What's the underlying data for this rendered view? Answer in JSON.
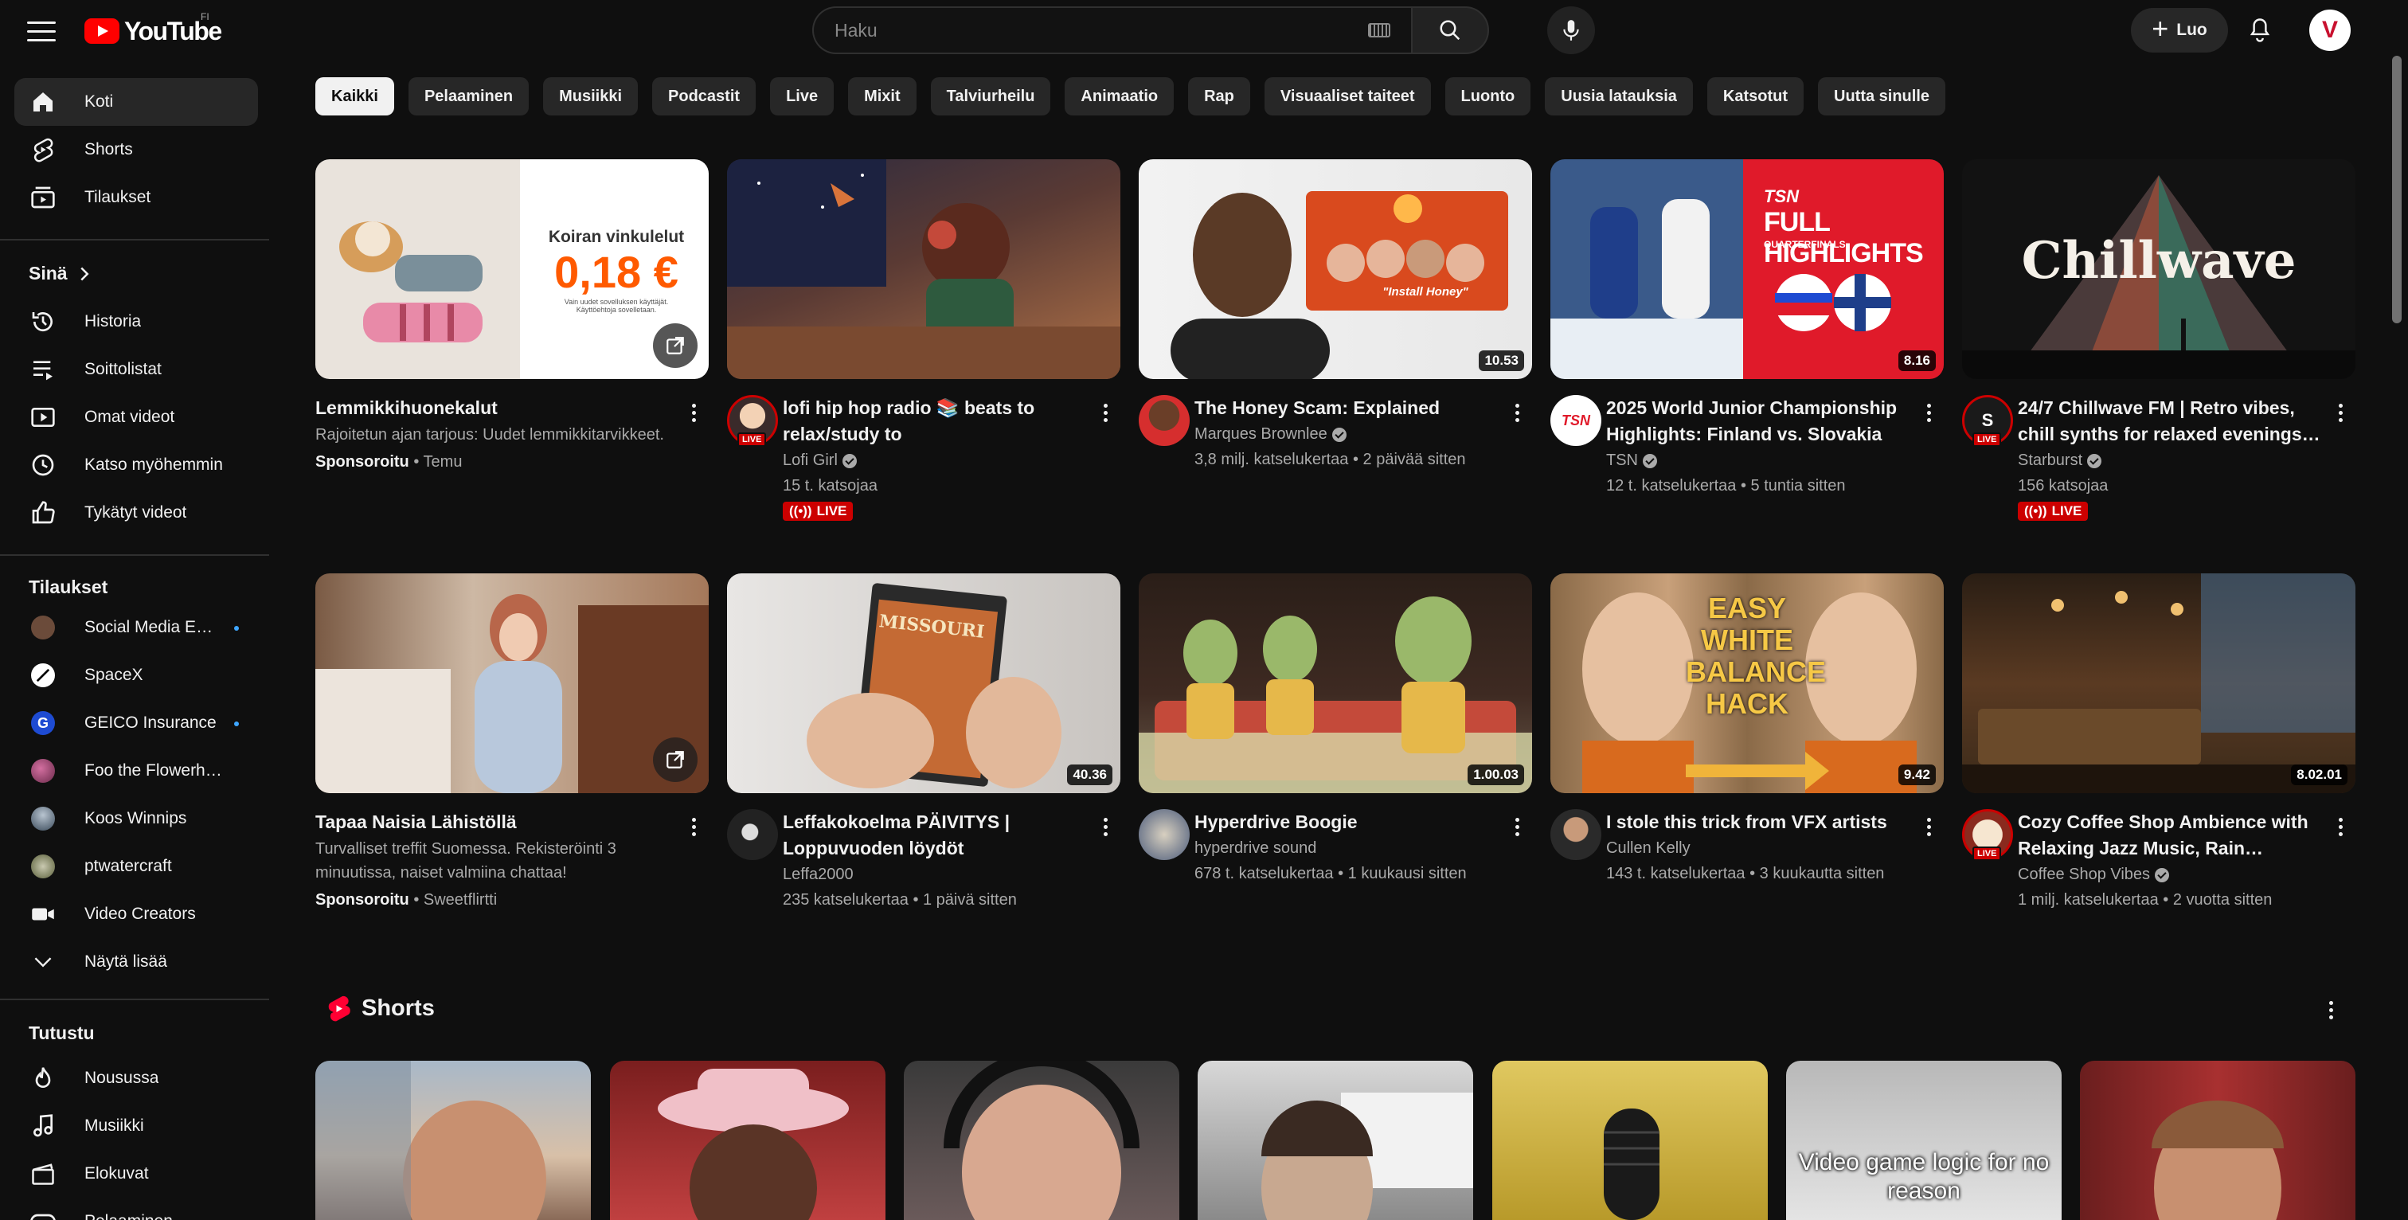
{
  "header": {
    "logo_text": "YouTube",
    "country_code": "FI",
    "search_placeholder": "Haku",
    "create_label": "Luo",
    "avatar_letter": "V"
  },
  "sidebar": {
    "main": [
      {
        "label": "Koti",
        "icon": "home-icon",
        "active": true
      },
      {
        "label": "Shorts",
        "icon": "shorts-icon"
      },
      {
        "label": "Tilaukset",
        "icon": "subscriptions-icon"
      }
    ],
    "you_heading": "Sinä",
    "you": [
      {
        "label": "Historia",
        "icon": "history-icon"
      },
      {
        "label": "Soittolistat",
        "icon": "playlists-icon"
      },
      {
        "label": "Omat videot",
        "icon": "your-videos-icon"
      },
      {
        "label": "Katso myöhemmin",
        "icon": "watch-later-icon"
      },
      {
        "label": "Tykätyt videot",
        "icon": "liked-videos-icon"
      }
    ],
    "subs_heading": "Tilaukset",
    "subscriptions": [
      {
        "label": "Social Media Examiner",
        "color": "#6b4b3a",
        "new": true
      },
      {
        "label": "SpaceX",
        "color": "#ffffff"
      },
      {
        "label": "GEICO Insurance",
        "color": "#1e4bd2",
        "new": true
      },
      {
        "label": "Foo the Flowerhorn",
        "color": "#b04a7a"
      },
      {
        "label": "Koos Winnips",
        "color": "#5a6a7a"
      },
      {
        "label": "ptwatercraft",
        "color": "#8a8f6a"
      },
      {
        "label": "Video Creators",
        "icon": "video-camera-icon"
      }
    ],
    "show_more": "Näytä lisää",
    "explore_heading": "Tutustu",
    "explore": [
      {
        "label": "Nousussa",
        "icon": "trending-icon"
      },
      {
        "label": "Musiikki",
        "icon": "music-icon"
      },
      {
        "label": "Elokuvat",
        "icon": "movies-icon"
      },
      {
        "label": "Pelaaminen",
        "icon": "gaming-icon"
      }
    ]
  },
  "chips": [
    "Kaikki",
    "Pelaaminen",
    "Musiikki",
    "Podcastit",
    "Live",
    "Mixit",
    "Talviurheilu",
    "Animaatio",
    "Rap",
    "Visuaaliset taiteet",
    "Luonto",
    "Uusia latauksia",
    "Katsotut",
    "Uutta sinulle"
  ],
  "videos": [
    {
      "title": "Lemmikkihuonekalut",
      "description": "Rajoitetun ajan tarjous: Uudet lemmikkitarvikkeet.",
      "sponsored": "Sponsoroitu",
      "advertiser": "Temu",
      "ad": true,
      "thumb_text": "Koiran vinkulelut",
      "thumb_price": "0,18 €",
      "thumb_small": "Vain uudet sovelluksen käyttäjät. Käyttöehtoja sovelletaan."
    },
    {
      "title": "lofi hip hop radio 📚 beats to relax/study to",
      "channel": "Lofi Girl",
      "verified": true,
      "stats": "15 t. katsojaa",
      "live": true,
      "live_label": "LIVE",
      "avatar_live": "LIVE"
    },
    {
      "title": "The Honey Scam: Explained",
      "channel": "Marques Brownlee",
      "verified": true,
      "stats": "3,8 milj. katselukertaa • 2 päivää sitten",
      "duration": "10.53",
      "thumb_caption": "\"Install Honey\""
    },
    {
      "title": "2025 World Junior Championship Highlights: Finland vs. Slovakia",
      "channel": "TSN",
      "verified": true,
      "stats": "12 t. katselukertaa • 5 tuntia sitten",
      "duration": "8.16",
      "thumb_brand": "TSN",
      "thumb_text": "FULL HIGHLIGHTS",
      "thumb_sub": "QUARTERFINALS"
    },
    {
      "title": "24/7 Chillwave FM | Retro vibes, chill synths for relaxed evenings…",
      "channel": "Starburst",
      "verified": true,
      "stats": "156 katsojaa",
      "live": true,
      "live_label": "LIVE",
      "avatar_live": "LIVE",
      "thumb_text": "Chillwave"
    },
    {
      "title": "Tapaa Naisia Lähistöllä",
      "description": "Turvalliset treffit Suomessa. Rekisteröinti 3 minuutissa, naiset valmiina chattaa!",
      "sponsored": "Sponsoroitu",
      "advertiser": "Sweetflirtti",
      "ad": true
    },
    {
      "title": "Leffakokoelma PÄIVITYS | Loppuvuoden löydöt",
      "channel": "Leffa2000",
      "stats": "235 katselukertaa • 1 päivä sitten",
      "duration": "40.36",
      "thumb_text": "MISSOURI"
    },
    {
      "title": "Hyperdrive Boogie",
      "channel": "hyperdrive sound",
      "stats": "678 t. katselukertaa • 1 kuukausi sitten",
      "duration": "1.00.03"
    },
    {
      "title": "I stole this trick from VFX artists",
      "channel": "Cullen Kelly",
      "stats": "143 t. katselukertaa • 3 kuukautta sitten",
      "duration": "9.42",
      "thumb_text": "EASY WHITE BALANCE HACK"
    },
    {
      "title": "Cozy Coffee Shop Ambience with Relaxing Jazz Music, Rain Sounds…",
      "channel": "Coffee Shop Vibes",
      "verified": true,
      "stats": "1 milj. katselukertaa • 2 vuotta sitten",
      "duration": "8.02.01",
      "avatar_live": "LIVE"
    }
  ],
  "shorts": {
    "heading": "Shorts",
    "items": [
      {
        "overlay": ""
      },
      {
        "overlay": ""
      },
      {
        "overlay": ""
      },
      {
        "overlay": ""
      },
      {
        "overlay": ""
      },
      {
        "overlay": "Video game logic for no reason"
      },
      {
        "overlay": ""
      }
    ]
  },
  "colors": {
    "background": "#0f0f0f",
    "chip": "#272727",
    "accent_red": "#ff0000",
    "live_red": "#cc0000",
    "text_secondary": "#aaaaaa"
  }
}
